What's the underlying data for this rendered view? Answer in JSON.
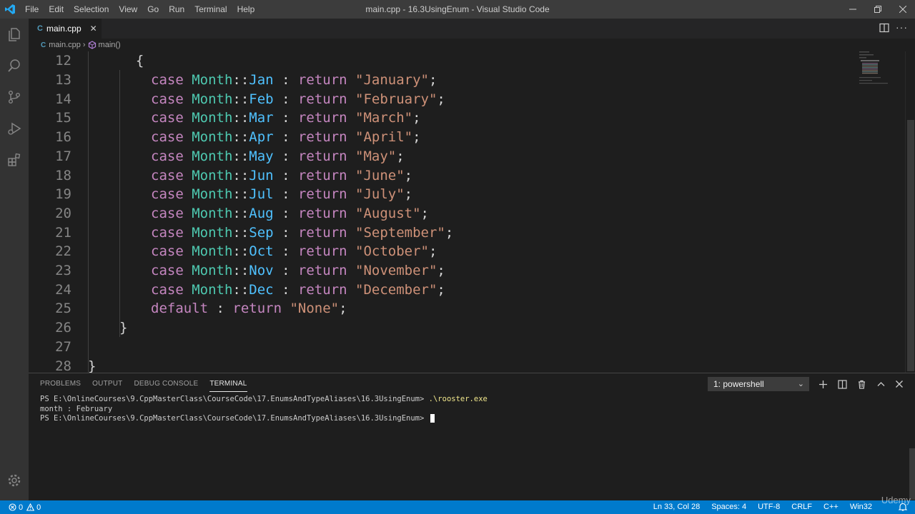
{
  "titlebar": {
    "menu": [
      "File",
      "Edit",
      "Selection",
      "View",
      "Go",
      "Run",
      "Terminal",
      "Help"
    ],
    "title": "main.cpp - 16.3UsingEnum - Visual Studio Code"
  },
  "tab": {
    "label": "main.cpp",
    "icon": "C",
    "close": "✕"
  },
  "breadcrumb": {
    "file": "main.cpp",
    "symbol": "main()"
  },
  "editor": {
    "lines": [
      {
        "num": "12",
        "tokens": [
          [
            "  ",
            "sp"
          ],
          [
            "{",
            "punc"
          ]
        ]
      },
      {
        "num": "13",
        "tokens": [
          [
            "case ",
            "kw"
          ],
          [
            "Month",
            "type"
          ],
          [
            "::",
            "punc"
          ],
          [
            "Jan",
            "enum"
          ],
          [
            " : ",
            "punc"
          ],
          [
            "return ",
            "kw"
          ],
          [
            "\"January\"",
            "str"
          ],
          [
            ";",
            "punc"
          ]
        ]
      },
      {
        "num": "14",
        "tokens": [
          [
            "case ",
            "kw"
          ],
          [
            "Month",
            "type"
          ],
          [
            "::",
            "punc"
          ],
          [
            "Feb",
            "enum"
          ],
          [
            " : ",
            "punc"
          ],
          [
            "return ",
            "kw"
          ],
          [
            "\"February\"",
            "str"
          ],
          [
            ";",
            "punc"
          ]
        ]
      },
      {
        "num": "15",
        "tokens": [
          [
            "case ",
            "kw"
          ],
          [
            "Month",
            "type"
          ],
          [
            "::",
            "punc"
          ],
          [
            "Mar",
            "enum"
          ],
          [
            " : ",
            "punc"
          ],
          [
            "return ",
            "kw"
          ],
          [
            "\"March\"",
            "str"
          ],
          [
            ";",
            "punc"
          ]
        ]
      },
      {
        "num": "16",
        "tokens": [
          [
            "case ",
            "kw"
          ],
          [
            "Month",
            "type"
          ],
          [
            "::",
            "punc"
          ],
          [
            "Apr",
            "enum"
          ],
          [
            " : ",
            "punc"
          ],
          [
            "return ",
            "kw"
          ],
          [
            "\"April\"",
            "str"
          ],
          [
            ";",
            "punc"
          ]
        ]
      },
      {
        "num": "17",
        "tokens": [
          [
            "case ",
            "kw"
          ],
          [
            "Month",
            "type"
          ],
          [
            "::",
            "punc"
          ],
          [
            "May",
            "enum"
          ],
          [
            " : ",
            "punc"
          ],
          [
            "return ",
            "kw"
          ],
          [
            "\"May\"",
            "str"
          ],
          [
            ";",
            "punc"
          ]
        ]
      },
      {
        "num": "18",
        "tokens": [
          [
            "case ",
            "kw"
          ],
          [
            "Month",
            "type"
          ],
          [
            "::",
            "punc"
          ],
          [
            "Jun",
            "enum"
          ],
          [
            " : ",
            "punc"
          ],
          [
            "return ",
            "kw"
          ],
          [
            "\"June\"",
            "str"
          ],
          [
            ";",
            "punc"
          ]
        ]
      },
      {
        "num": "19",
        "tokens": [
          [
            "case ",
            "kw"
          ],
          [
            "Month",
            "type"
          ],
          [
            "::",
            "punc"
          ],
          [
            "Jul",
            "enum"
          ],
          [
            " : ",
            "punc"
          ],
          [
            "return ",
            "kw"
          ],
          [
            "\"July\"",
            "str"
          ],
          [
            ";",
            "punc"
          ]
        ]
      },
      {
        "num": "20",
        "tokens": [
          [
            "case ",
            "kw"
          ],
          [
            "Month",
            "type"
          ],
          [
            "::",
            "punc"
          ],
          [
            "Aug",
            "enum"
          ],
          [
            " : ",
            "punc"
          ],
          [
            "return ",
            "kw"
          ],
          [
            "\"August\"",
            "str"
          ],
          [
            ";",
            "punc"
          ]
        ]
      },
      {
        "num": "21",
        "tokens": [
          [
            "case ",
            "kw"
          ],
          [
            "Month",
            "type"
          ],
          [
            "::",
            "punc"
          ],
          [
            "Sep",
            "enum"
          ],
          [
            " : ",
            "punc"
          ],
          [
            "return ",
            "kw"
          ],
          [
            "\"September\"",
            "str"
          ],
          [
            ";",
            "punc"
          ]
        ]
      },
      {
        "num": "22",
        "tokens": [
          [
            "case ",
            "kw"
          ],
          [
            "Month",
            "type"
          ],
          [
            "::",
            "punc"
          ],
          [
            "Oct",
            "enum"
          ],
          [
            " : ",
            "punc"
          ],
          [
            "return ",
            "kw"
          ],
          [
            "\"October\"",
            "str"
          ],
          [
            ";",
            "punc"
          ]
        ]
      },
      {
        "num": "23",
        "tokens": [
          [
            "case ",
            "kw"
          ],
          [
            "Month",
            "type"
          ],
          [
            "::",
            "punc"
          ],
          [
            "Nov",
            "enum"
          ],
          [
            " : ",
            "punc"
          ],
          [
            "return ",
            "kw"
          ],
          [
            "\"November\"",
            "str"
          ],
          [
            ";",
            "punc"
          ]
        ]
      },
      {
        "num": "24",
        "tokens": [
          [
            "case ",
            "kw"
          ],
          [
            "Month",
            "type"
          ],
          [
            "::",
            "punc"
          ],
          [
            "Dec",
            "enum"
          ],
          [
            " : ",
            "punc"
          ],
          [
            "return ",
            "kw"
          ],
          [
            "\"December\"",
            "str"
          ],
          [
            ";",
            "punc"
          ]
        ]
      },
      {
        "num": "25",
        "tokens": [
          [
            "default",
            "kw"
          ],
          [
            " : ",
            "punc"
          ],
          [
            "return ",
            "kw"
          ],
          [
            "\"None\"",
            "str"
          ],
          [
            ";",
            "punc"
          ]
        ]
      },
      {
        "num": "26",
        "tokens": [
          [
            "}",
            "punc"
          ]
        ]
      },
      {
        "num": "27",
        "tokens": []
      },
      {
        "num": "28",
        "tokens": [
          [
            "}",
            "punc"
          ]
        ]
      }
    ]
  },
  "panel": {
    "tabs": [
      "PROBLEMS",
      "OUTPUT",
      "DEBUG CONSOLE",
      "TERMINAL"
    ],
    "active_tab": "TERMINAL",
    "terminal_select": "1: powershell",
    "terminal": {
      "line1_prompt": "PS E:\\OnlineCourses\\9.CppMasterClass\\CourseCode\\17.EnumsAndTypeAliases\\16.3UsingEnum> ",
      "line1_cmd": ".\\rooster.exe",
      "line2": "month : February",
      "line3_prompt": "PS E:\\OnlineCourses\\9.CppMasterClass\\CourseCode\\17.EnumsAndTypeAliases\\16.3UsingEnum> "
    }
  },
  "statusbar": {
    "errors": "0",
    "warnings": "0",
    "position": "Ln 33, Col 28",
    "spaces": "Spaces: 4",
    "encoding": "UTF-8",
    "eol": "CRLF",
    "language": "C++",
    "platform": "Win32"
  },
  "watermark": "Udemy",
  "colors": {
    "keyword": "#c586c0",
    "type": "#4ec9b0",
    "enum_member": "#4fc1ff",
    "string": "#ce9178",
    "statusbar": "#007acc"
  }
}
